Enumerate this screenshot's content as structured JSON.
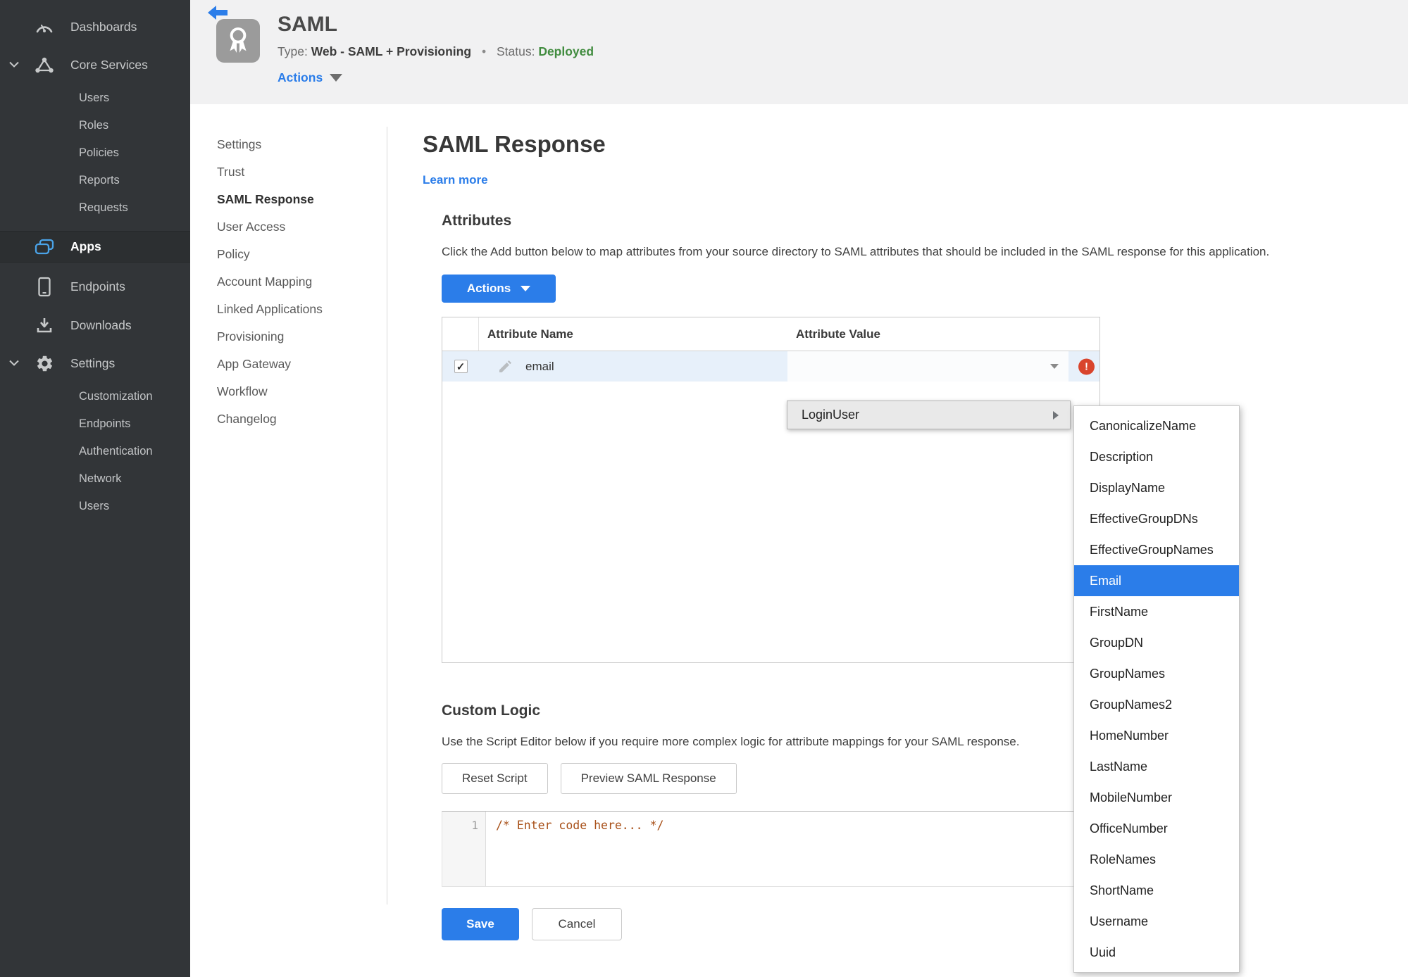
{
  "colors": {
    "accent": "#2b7de9",
    "status_green": "#418c3f",
    "error_red": "#d9442c"
  },
  "sidebar": {
    "dashboards": "Dashboards",
    "core_services": "Core Services",
    "core_children": [
      "Users",
      "Roles",
      "Policies",
      "Reports",
      "Requests"
    ],
    "apps": "Apps",
    "endpoints": "Endpoints",
    "downloads": "Downloads",
    "settings": "Settings",
    "settings_children": [
      "Customization",
      "Endpoints",
      "Authentication",
      "Network",
      "Users"
    ]
  },
  "header": {
    "app_name": "SAML",
    "type_label": "Type:",
    "type_value": "Web - SAML + Provisioning",
    "separator": "•",
    "status_label": "Status:",
    "status_value": "Deployed",
    "actions_label": "Actions"
  },
  "subnav": {
    "items": [
      {
        "label": "Settings"
      },
      {
        "label": "Trust"
      },
      {
        "label": "SAML Response",
        "active": true
      },
      {
        "label": "User Access"
      },
      {
        "label": "Policy"
      },
      {
        "label": "Account Mapping"
      },
      {
        "label": "Linked Applications"
      },
      {
        "label": "Provisioning"
      },
      {
        "label": "App Gateway"
      },
      {
        "label": "Workflow"
      },
      {
        "label": "Changelog"
      }
    ]
  },
  "main": {
    "title": "SAML Response",
    "learn_more": "Learn more",
    "attributes": {
      "heading": "Attributes",
      "description": "Click the Add button below to map attributes from your source directory to SAML attributes that should be included in the SAML response for this application.",
      "actions_button": "Actions",
      "table": {
        "columns": [
          "Attribute Name",
          "Attribute Value"
        ],
        "rows": [
          {
            "checked": "✓",
            "name": "email",
            "value": ""
          }
        ]
      }
    },
    "custom_logic": {
      "heading": "Custom Logic",
      "description": "Use the Script Editor below if you require more complex logic for attribute mappings for your SAML response.",
      "reset_button": "Reset Script",
      "preview_button": "Preview SAML Response",
      "editor": {
        "line_number": "1",
        "code": "/* Enter code here... */"
      }
    },
    "save_button": "Save",
    "cancel_button": "Cancel"
  },
  "value_menu": {
    "root_item": "LoginUser",
    "options": [
      {
        "label": "CanonicalizeName"
      },
      {
        "label": "Description"
      },
      {
        "label": "DisplayName"
      },
      {
        "label": "EffectiveGroupDNs"
      },
      {
        "label": "EffectiveGroupNames"
      },
      {
        "label": "Email",
        "selected": true
      },
      {
        "label": "FirstName"
      },
      {
        "label": "GroupDN"
      },
      {
        "label": "GroupNames"
      },
      {
        "label": "GroupNames2"
      },
      {
        "label": "HomeNumber"
      },
      {
        "label": "LastName"
      },
      {
        "label": "MobileNumber"
      },
      {
        "label": "OfficeNumber"
      },
      {
        "label": "RoleNames"
      },
      {
        "label": "ShortName"
      },
      {
        "label": "Username"
      },
      {
        "label": "Uuid"
      }
    ]
  }
}
